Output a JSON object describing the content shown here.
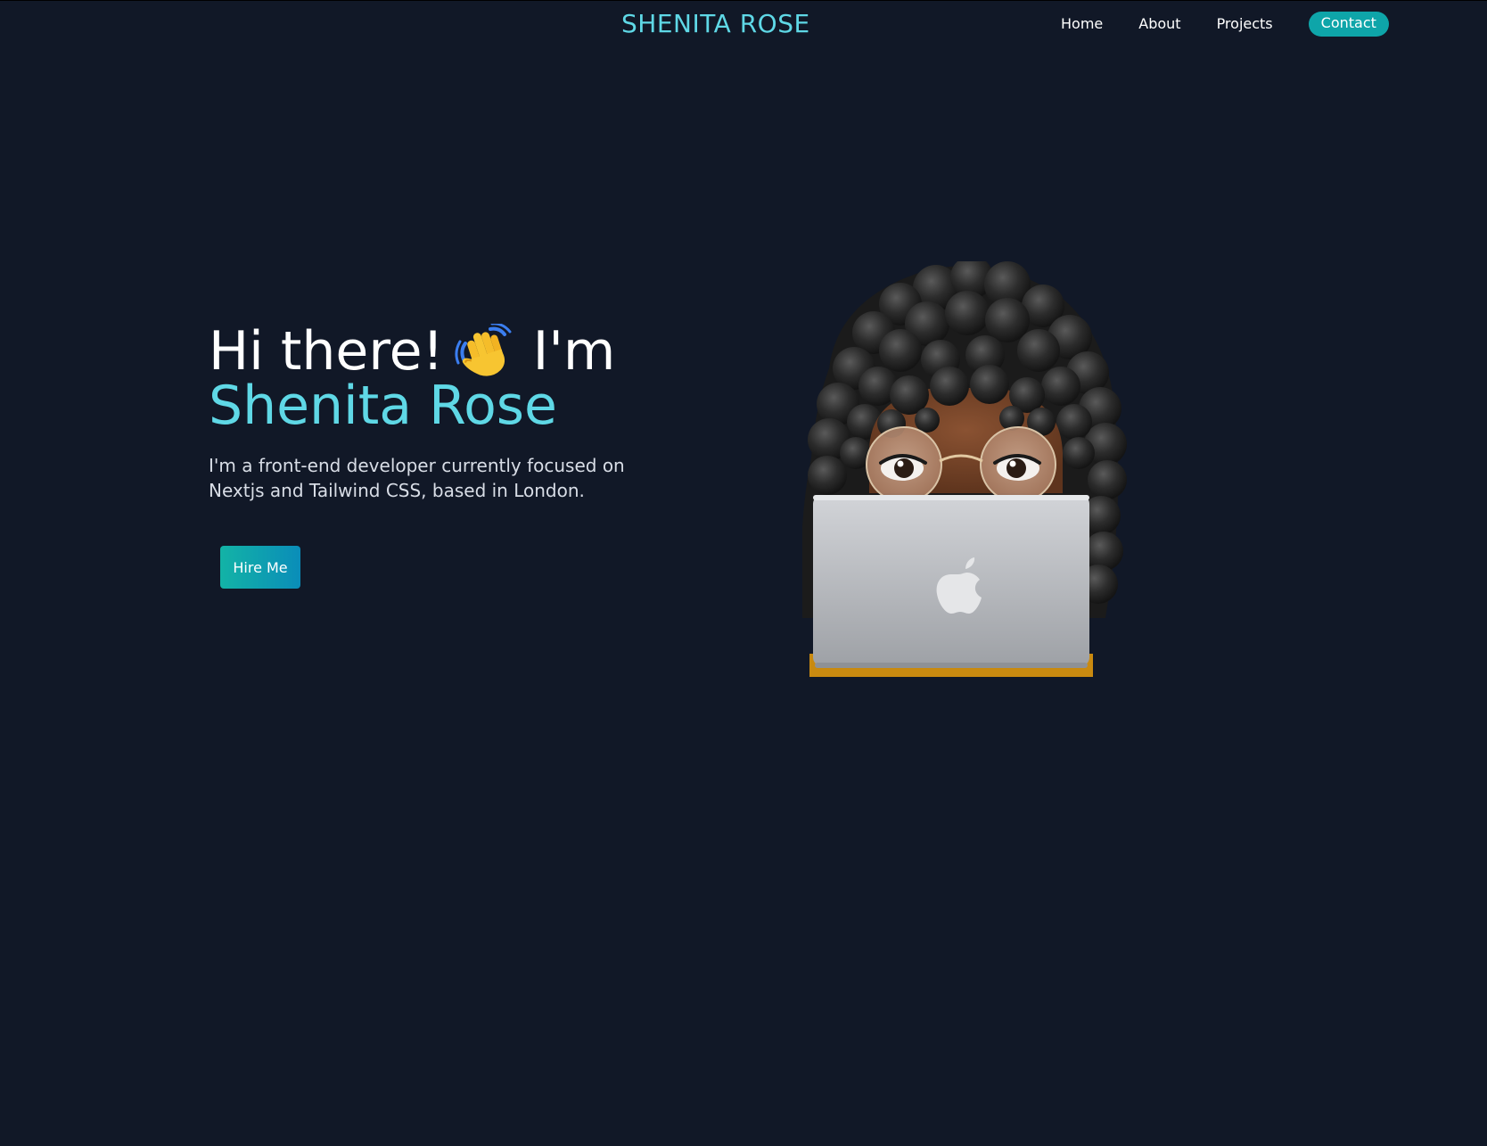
{
  "header": {
    "brand": "SHENITA ROSE",
    "nav": {
      "home": "Home",
      "about": "About",
      "projects": "Projects",
      "contact": "Contact"
    }
  },
  "hero": {
    "greeting": "Hi there!",
    "im": "I'm",
    "name": "Shenita Rose",
    "description": "I'm a front-end developer currently focused on Nextjs and Tailwind CSS, based in London.",
    "cta": "Hire Me",
    "wave_icon": "waving-hand-icon",
    "avatar_icon": "memoji-avatar-laptop"
  },
  "colors": {
    "background": "#111827",
    "accent": "#5fd8e6",
    "button": "#0ea5a9"
  }
}
